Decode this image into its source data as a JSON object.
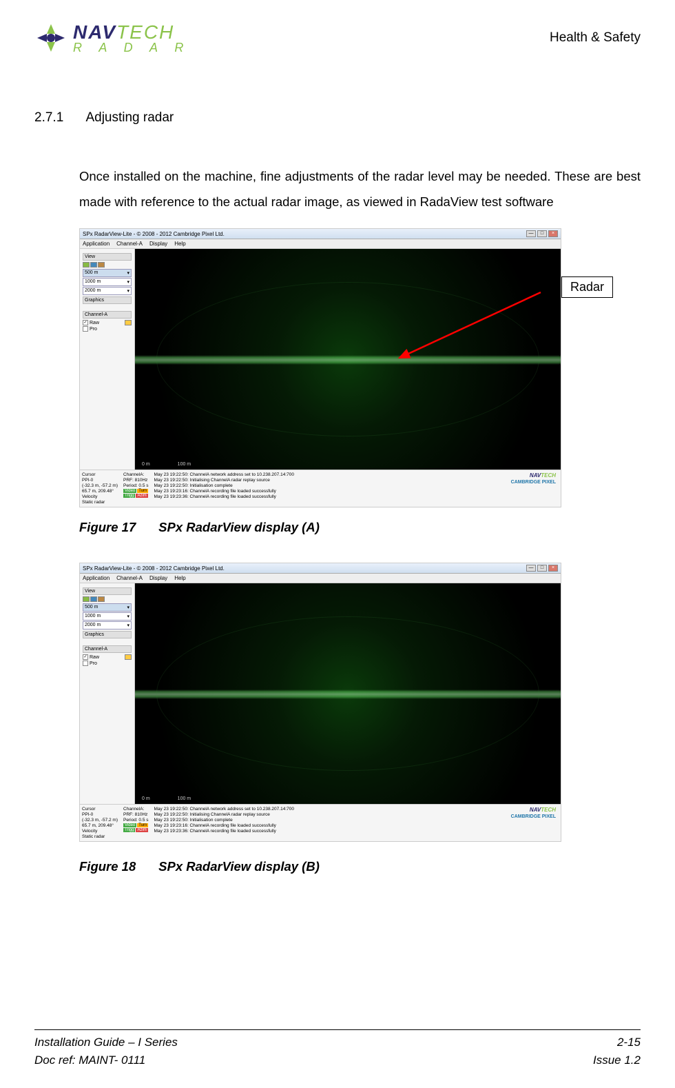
{
  "header": {
    "logo_nav": "NAV",
    "logo_tech": "TECH",
    "logo_sub": "R A D A R",
    "right": "Health & Safety"
  },
  "section": {
    "number": "2.7.1",
    "title": "Adjusting radar"
  },
  "body": "Once installed on the machine, fine adjustments of the radar level may be needed. These are best made with reference to the actual radar image, as viewed in RadaView test software",
  "screenshot": {
    "title": "SPx RadarView-Lite - © 2008 - 2012 Cambridge Pixel Ltd.",
    "menu": [
      "Application",
      "Channel-A",
      "Display",
      "Help"
    ],
    "side": {
      "view": "View",
      "ranges": [
        "500 m",
        "1000 m",
        "2000 m"
      ],
      "graphics": "Graphics",
      "channel": "Channel-A",
      "raw": "Raw",
      "pro": "Pro"
    },
    "scale": {
      "zero": "0 m",
      "hundred": "100 m"
    },
    "status": {
      "cursor": "Cursor",
      "ppi": "PPI-0",
      "coords": "(-32.3 m, -57.2 m)",
      "range": "65.7 m, 209.48°",
      "velocity": "Velocity",
      "static": "Static radar",
      "chanA": "ChannelA:",
      "prf": "PRF: 810Hz",
      "period": "Period: 0.5 s",
      "badges": {
        "video": "Video",
        "turn": "Turn",
        "trigg": "Trigg",
        "azim": "Azim"
      },
      "log": [
        "May 23 19:22:50: ChannelA network address set to 10.238.207.14:700",
        "May 23 19:22:50: Initialising ChannelA radar replay source",
        "May 23 19:22:50: Initialisation complete",
        "May 23 19:23:16: ChannelA recording file loaded successfully",
        "May 23 19:23:36: ChannelA recording file loaded successfully"
      ],
      "cambridge": "CAMBRIDGE PIXEL"
    }
  },
  "annotation": "Radar",
  "figures": {
    "f17_num": "Figure 17",
    "f17_title": "SPx RadarView display (A)",
    "f18_num": "Figure 18",
    "f18_title": "SPx RadarView display (B)"
  },
  "footer": {
    "guide": "Installation Guide – I Series",
    "page": "2-15",
    "docref": "Doc ref: MAINT- 0111",
    "issue": "Issue 1.2"
  }
}
